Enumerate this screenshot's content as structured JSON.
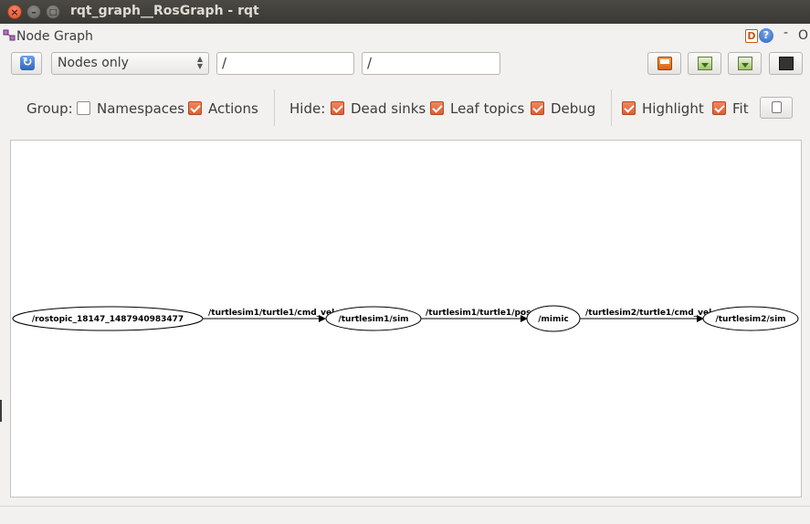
{
  "window": {
    "title": "rqt_graph__RosGraph - rqt",
    "close_glyph": "×",
    "min_glyph": "–",
    "max_glyph": "□"
  },
  "plugin": {
    "title": "Node Graph",
    "help_d": "D",
    "help_q": "?",
    "dash": "-",
    "o": "O"
  },
  "toolbar": {
    "refresh_glyph": "↻",
    "mode": "Nodes only",
    "namespace_filter": "/",
    "topic_filter": "/"
  },
  "options": {
    "group_label": "Group:",
    "namespaces": {
      "label": "Namespaces",
      "checked": false
    },
    "actions": {
      "label": "Actions",
      "checked": true
    },
    "hide_label": "Hide:",
    "dead_sinks": {
      "label": "Dead sinks",
      "checked": true
    },
    "leaf_topics": {
      "label": "Leaf topics",
      "checked": true
    },
    "debug": {
      "label": "Debug",
      "checked": true
    },
    "highlight": {
      "label": "Highlight",
      "checked": true
    },
    "fit": {
      "label": "Fit",
      "checked": true
    }
  },
  "graph": {
    "nodes": [
      {
        "id": "n0",
        "label": "/rostopic_18147_1487940983477"
      },
      {
        "id": "n1",
        "label": "/turtlesim1/sim"
      },
      {
        "id": "n2",
        "label": "/mimic"
      },
      {
        "id": "n3",
        "label": "/turtlesim2/sim"
      }
    ],
    "edges": [
      {
        "from": "n0",
        "to": "n1",
        "label": "/turtlesim1/turtle1/cmd_vel"
      },
      {
        "from": "n1",
        "to": "n2",
        "label": "/turtlesim1/turtle1/pose"
      },
      {
        "from": "n2",
        "to": "n3",
        "label": "/turtlesim2/turtle1/cmd_vel"
      }
    ]
  }
}
